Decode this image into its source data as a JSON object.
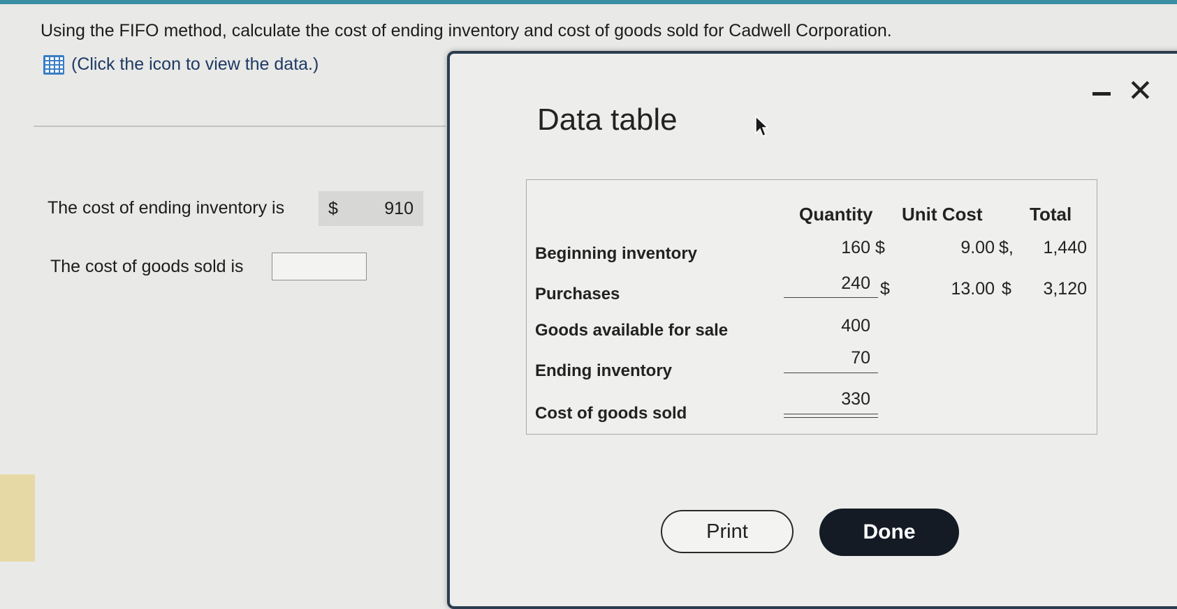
{
  "question": {
    "text": "Using the FIFO method, calculate the cost of ending inventory and cost of goods sold for Cadwell Corporation.",
    "hint_text": "(Click the icon to view the data.)",
    "hint_icon": "table-grid-icon"
  },
  "answers": {
    "ending_inventory_label": "The cost of ending inventory is",
    "ending_inventory_currency": "$",
    "ending_inventory_value": "910",
    "cogs_label": "The cost of goods sold is",
    "cogs_value": ""
  },
  "modal": {
    "title": "Data table",
    "minimize_icon": "minimize-icon",
    "close_glyph": "✕",
    "print_label": "Print",
    "done_label": "Done"
  },
  "table": {
    "headers": {
      "quantity": "Quantity",
      "unit_cost": "Unit Cost",
      "total": "Total"
    },
    "rows": [
      {
        "label": "Beginning inventory",
        "quantity": "160",
        "qty_currency": "$",
        "unit_cost": "9.00",
        "uc_currency": "$,",
        "total": "1,440"
      },
      {
        "label": "Purchases",
        "quantity": "240",
        "qty_currency": "$",
        "unit_cost": "13.00",
        "uc_currency": "$",
        "total": "3,120"
      },
      {
        "label": "Goods available for sale",
        "quantity": "400"
      },
      {
        "label": "Ending inventory",
        "quantity": "70"
      },
      {
        "label": "Cost of goods sold",
        "quantity": "330"
      }
    ]
  },
  "colors": {
    "accent_bar": "#3b8fa5",
    "hint_link": "#1e3a64",
    "done_button": "#141b25",
    "modal_border": "#2b3d4f"
  }
}
